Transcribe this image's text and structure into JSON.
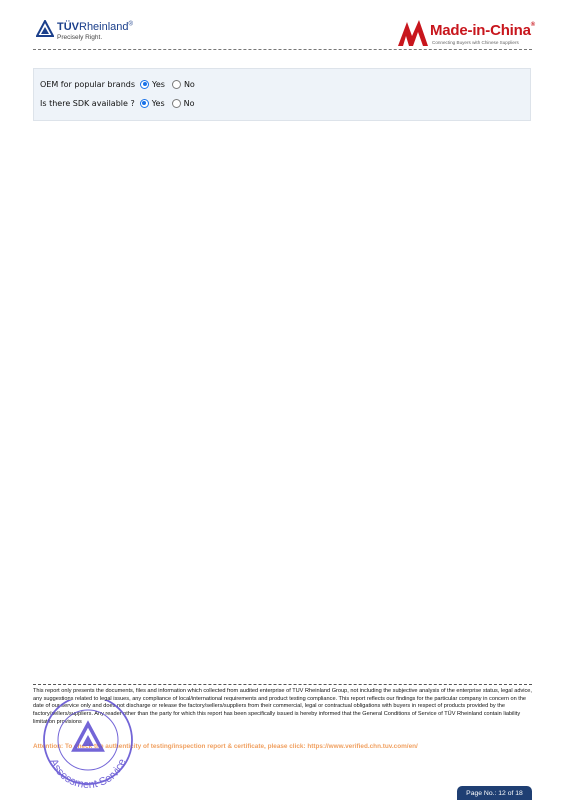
{
  "header": {
    "tuv_name_bold": "TÜV",
    "tuv_name_rest": "Rheinland",
    "tuv_reg": "®",
    "tuv_tagline": "Precisely Right.",
    "mic_name": "Made-in-China",
    "mic_reg": "®",
    "mic_tagline": "Connecting Buyers with Chinese Suppliers"
  },
  "questions": [
    {
      "label": "OEM for popular brands",
      "options": [
        "Yes",
        "No"
      ],
      "selected": "Yes"
    },
    {
      "label": "Is there SDK available ?",
      "options": [
        "Yes",
        "No"
      ],
      "selected": "Yes"
    }
  ],
  "footer": {
    "disclaimer": "This report only presents the documents, files and information which collected from audited enterprise of TUV Rheinland Group, not including the subjective analysis of the enterprise status, legal advice, any suggestions related to legal issues, any compliance of local/international requirements and product testing compliance. This report reflects our findings for the particular company in concern on the date of our service only and does not discharge or release the factory/sellers/suppliers from their commercial, legal or contractual obligations with buyers in respect of products provided by the factory/sellers/suppliers. Any reader other than the party for which this report has been specifically issued is hereby informed that the General Conditions of Service of TÜV Rheinland contain liability limitation provisions",
    "attention": "Attention: To check the authenticity of testing/inspection report & certificate, please click:  https://www.verified.chn.tuv.com/en/",
    "stamp_text": "Assessment Service",
    "page_label": "Page No.: 12 of 18"
  },
  "colors": {
    "tuv_blue": "#1b3f8b",
    "mic_red": "#c8161d",
    "radio_selected": "#1a73e8",
    "panel_bg": "#eef3f9",
    "attention_orange": "#f0a060",
    "page_badge": "#1f3f73",
    "stamp_purple": "#5b4bd1"
  }
}
